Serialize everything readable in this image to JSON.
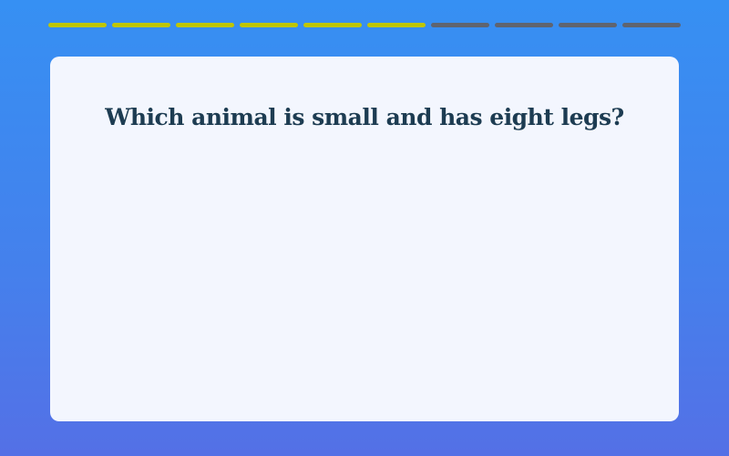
{
  "progress": {
    "total_segments": 10,
    "completed_segments": 6,
    "completed_color": "#bfc600",
    "remaining_color": "#5f6470"
  },
  "question": {
    "text": "Which animal is small and has eight legs?"
  }
}
